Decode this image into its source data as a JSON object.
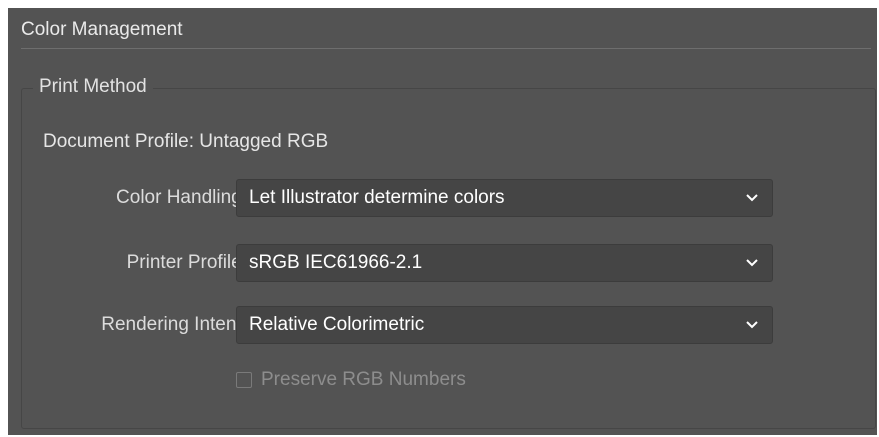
{
  "panel": {
    "title": "Color Management"
  },
  "print_method": {
    "group_title": "Print Method",
    "document_profile_text": "Document Profile: Untagged RGB",
    "color_handling": {
      "label": "Color Handling:",
      "value": "Let Illustrator determine colors"
    },
    "printer_profile": {
      "label": "Printer Profile:",
      "value": "sRGB IEC61966-2.1"
    },
    "rendering_intent": {
      "label": "Rendering Intent:",
      "value": "Relative Colorimetric"
    },
    "preserve_rgb": {
      "label": "Preserve RGB Numbers",
      "checked": false,
      "enabled": false
    }
  },
  "icons": {
    "dropdown": "chevron-down-icon"
  },
  "colors": {
    "panel_bg": "#535353",
    "field_bg": "#454545",
    "text": "#e6e6e6"
  }
}
